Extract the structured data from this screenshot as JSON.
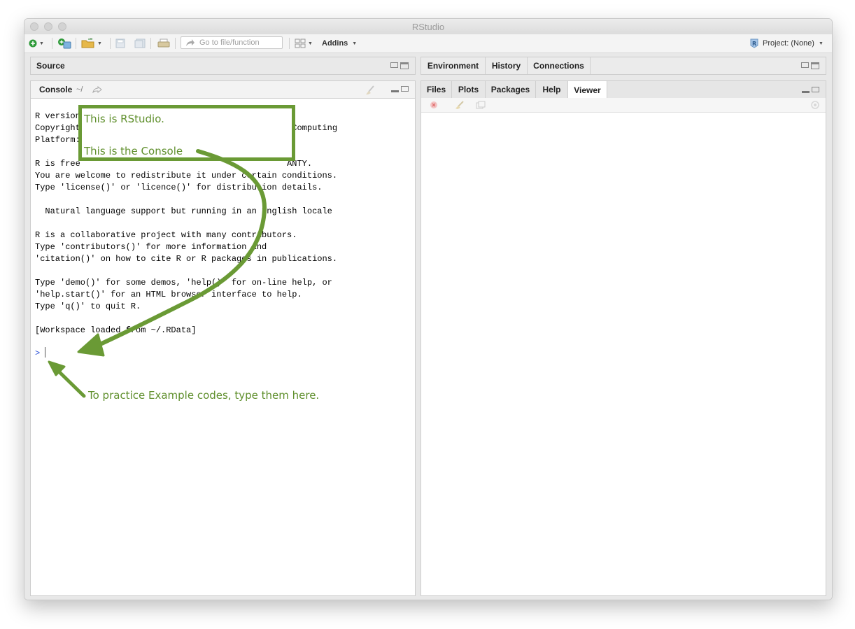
{
  "window": {
    "title": "RStudio"
  },
  "toolbar": {
    "goto_placeholder": "Go to file/function",
    "addins_label": "Addins",
    "project_label": "Project: (None)"
  },
  "source_pane": {
    "title": "Source"
  },
  "console_pane": {
    "tab_label": "Console",
    "path": "~/",
    "lines": [
      "R version",
      "Copyright                                          Computing",
      "Platform:",
      "",
      "R is free                                         ANTY.",
      "You are welcome to redistribute it under certain conditions.",
      "Type 'license()' or 'licence()' for distribution details.",
      "",
      "  Natural language support but running in an English locale",
      "",
      "R is a collaborative project with many contributors.",
      "Type 'contributors()' for more information and",
      "'citation()' on how to cite R or R packages in publications.",
      "",
      "Type 'demo()' for some demos, 'help()' for on-line help, or",
      "'help.start()' for an HTML browser interface to help.",
      "Type 'q()' to quit R.",
      "",
      "[Workspace loaded from ~/.RData]"
    ],
    "prompt": ">"
  },
  "env_pane": {
    "tabs": [
      "Environment",
      "History",
      "Connections"
    ]
  },
  "files_pane": {
    "tabs": [
      "Files",
      "Plots",
      "Packages",
      "Help",
      "Viewer"
    ],
    "active_tab": "Viewer"
  },
  "annotations": {
    "line1": "This is RStudio.",
    "line2": "This is the Console",
    "hint": "To practice Example codes, type them here.",
    "color": "#6a9a35"
  }
}
